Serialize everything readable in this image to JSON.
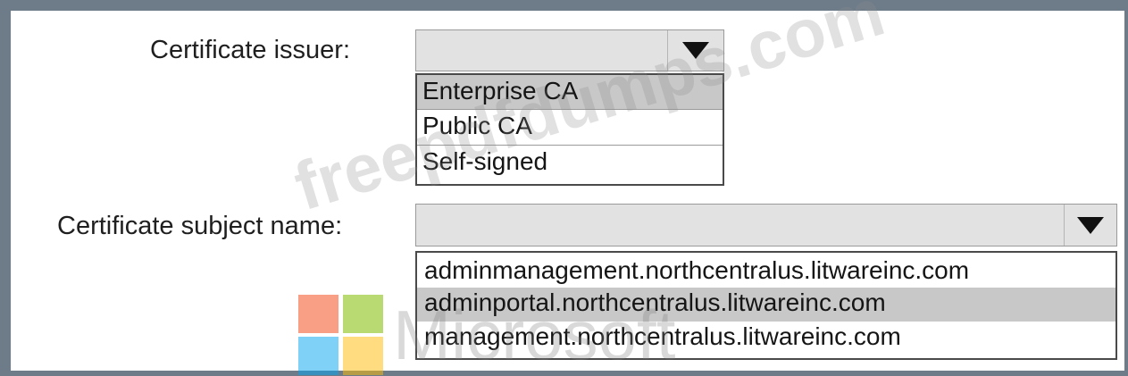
{
  "form": {
    "issuer_label": "Certificate issuer:",
    "issuer_options": [
      "Enterprise CA",
      "Public CA",
      "Self-signed"
    ],
    "issuer_selected": "Enterprise CA",
    "subject_label": "Certificate subject name:",
    "subject_options": [
      "adminmanagement.northcentralus.litwareinc.com",
      "adminportal.northcentralus.litwareinc.com",
      "management.northcentralus.litwareinc.com"
    ],
    "subject_selected": "adminportal.northcentralus.litwareinc.com"
  },
  "watermark": {
    "site": "freepdfdumps.com",
    "brand": "Microsoft",
    "logo_colors": [
      "#f25022",
      "#7fba00",
      "#00a4ef",
      "#ffb900"
    ]
  },
  "icons": {
    "dropdown": "chevron-down-icon"
  }
}
